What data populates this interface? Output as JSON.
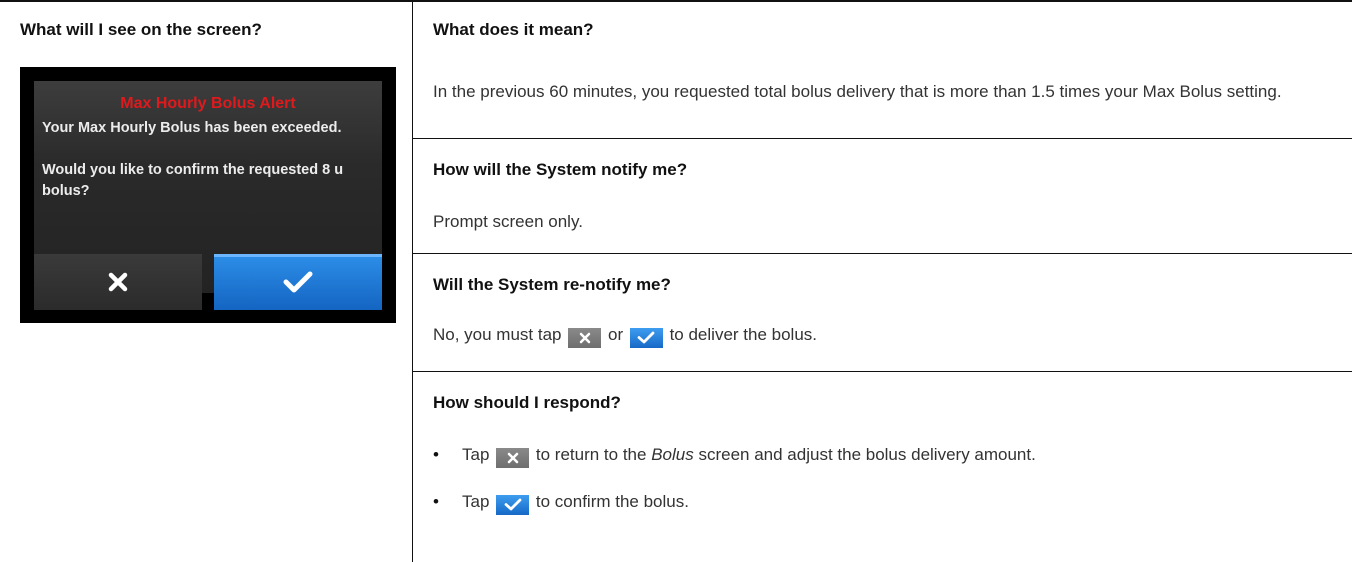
{
  "left": {
    "heading": "What will I see on the screen?",
    "screen": {
      "title": "Max Hourly Bolus Alert",
      "message_1": "Your Max Hourly Bolus has been exceeded.",
      "message_2": "Would you like to confirm the requested 8 u bolus?",
      "cancel_icon": "x-icon",
      "confirm_icon": "check-icon"
    }
  },
  "right": {
    "meaning": {
      "heading": "What does it mean?",
      "text": "In the previous 60 minutes, you requested total bolus delivery that is more than 1.5 times your Max Bolus setting."
    },
    "notify": {
      "heading": "How will the System notify me?",
      "text": "Prompt screen only."
    },
    "renotify": {
      "heading": "Will the System re-notify me?",
      "text_before": "No, you must tap",
      "text_mid": "or",
      "text_after": "to deliver the bolus."
    },
    "respond": {
      "heading": "How should I respond?",
      "bullet_1_before": "Tap",
      "bullet_1_after_a": "to return to the",
      "bullet_1_italic": "Bolus",
      "bullet_1_after_b": "screen and adjust the bolus delivery amount.",
      "bullet_2_before": "Tap",
      "bullet_2_after": "to confirm the bolus."
    }
  },
  "colors": {
    "alert_title": "#e0191c",
    "confirm_blue": "#1e7bd8",
    "screen_bg": "#2a2a2a"
  }
}
